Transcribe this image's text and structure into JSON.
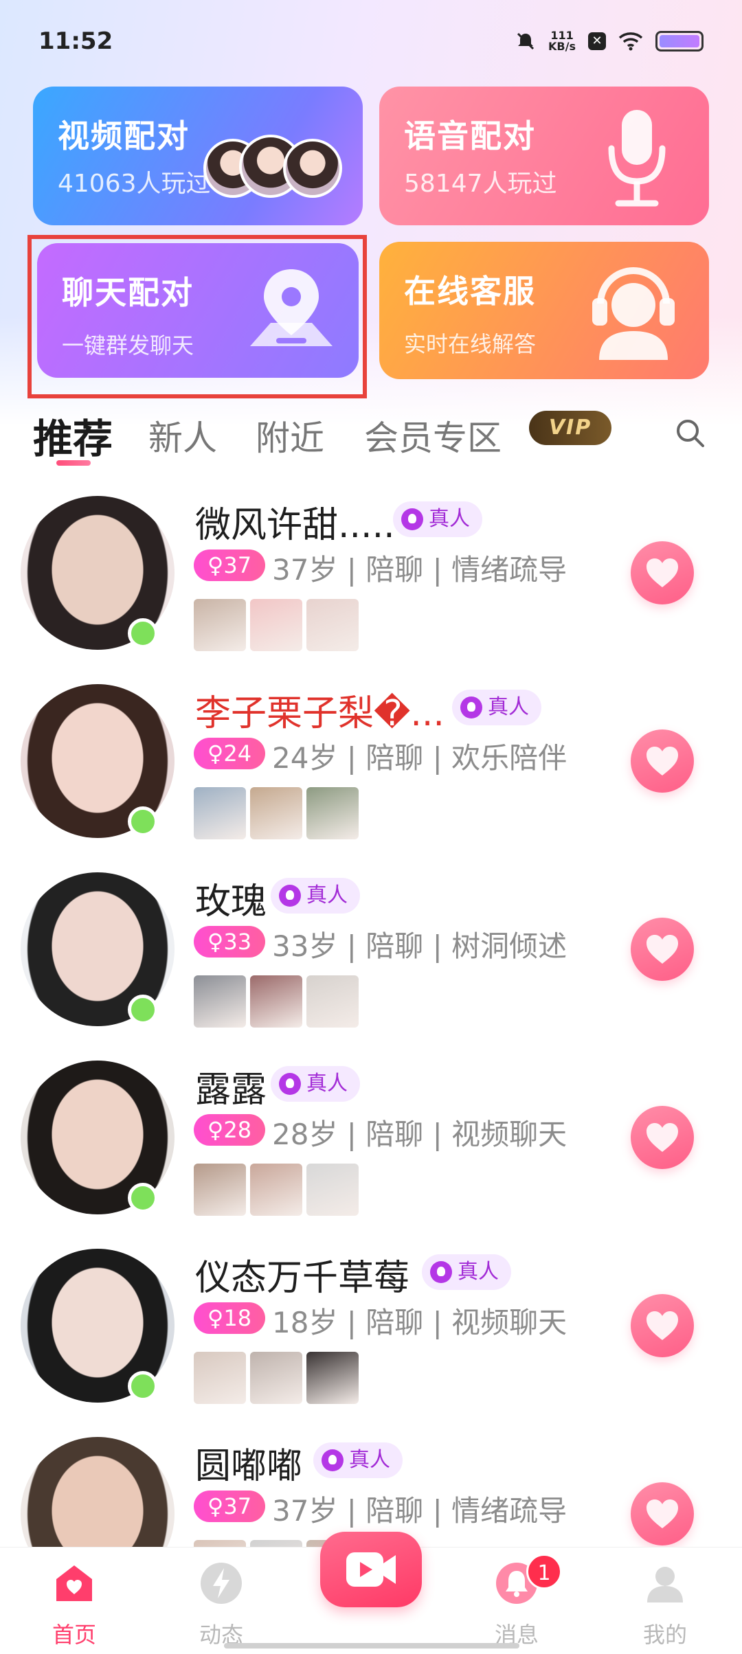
{
  "status_bar": {
    "time": "11:52",
    "net_speed_value": "111",
    "net_speed_unit": "KB/s"
  },
  "feature_cards": {
    "video": {
      "title": "视频配对",
      "subtitle": "41063人玩过"
    },
    "voice": {
      "title": "语音配对",
      "subtitle": "58147人玩过"
    },
    "chat": {
      "title": "聊天配对",
      "subtitle": "一键群发聊天"
    },
    "service": {
      "title": "在线客服",
      "subtitle": "实时在线解答"
    }
  },
  "tabs": {
    "items": [
      "推荐",
      "新人",
      "附近",
      "会员专区"
    ],
    "vip_label": "VIP"
  },
  "users": [
    {
      "name": "微风许甜.....",
      "badge": "真人",
      "age": "37",
      "meta": "37岁 | 陪聊 | 情绪疏导",
      "name_color": "#1e1e1e"
    },
    {
      "name": "李子栗子梨�...",
      "badge": "真人",
      "age": "24",
      "meta": "24岁 | 陪聊 | 欢乐陪伴",
      "name_color": "#e0322b"
    },
    {
      "name": "玫瑰",
      "badge": "真人",
      "age": "33",
      "meta": "33岁 | 陪聊 | 树洞倾述",
      "name_color": "#1e1e1e"
    },
    {
      "name": "露露",
      "badge": "真人",
      "age": "28",
      "meta": "28岁 | 陪聊 | 视频聊天",
      "name_color": "#1e1e1e"
    },
    {
      "name": "仪态万千草莓",
      "badge": "真人",
      "age": "18",
      "meta": "18岁 | 陪聊 | 视频聊天",
      "name_color": "#1e1e1e"
    },
    {
      "name": "圆嘟嘟",
      "badge": "真人",
      "age": "37",
      "meta": "37岁 | 陪聊 | 情绪疏导",
      "name_color": "#1e1e1e"
    }
  ],
  "bottom_nav": {
    "home": "首页",
    "moments": "动态",
    "messages": "消息",
    "messages_badge": "1",
    "mine": "我的"
  },
  "colors": {
    "accent": "#ff3e6c",
    "online": "#7ee05a",
    "real_badge": "#a22bd6",
    "highlight": "#e8423c"
  }
}
